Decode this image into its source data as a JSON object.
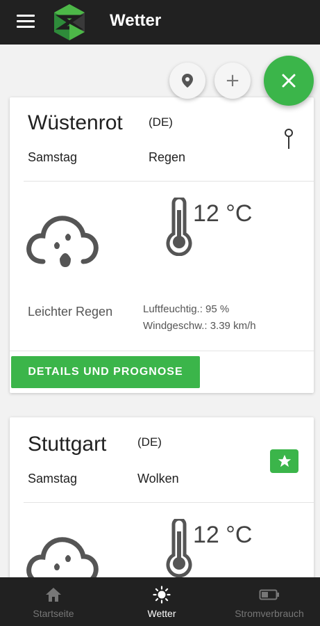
{
  "app": {
    "title": "Wetter"
  },
  "cards": [
    {
      "city": "Wüstenrot",
      "country": "(DE)",
      "day": "Samstag",
      "condition": "Regen",
      "temperature": "12 °C",
      "description": "Leichter Regen",
      "humidity": "Luftfeuchtig.: 95 %",
      "wind": "Windgeschw.: 3.39 km/h",
      "details_button": "DETAILS UND PROGNOSE"
    },
    {
      "city": "Stuttgart",
      "country": "(DE)",
      "day": "Samstag",
      "condition": "Wolken",
      "temperature": "12 °C"
    }
  ],
  "fab": {
    "add_symbol": "+"
  },
  "bottom_nav": [
    {
      "label": "Startseite",
      "icon": "home-icon"
    },
    {
      "label": "Wetter",
      "icon": "sun-icon"
    },
    {
      "label": "Stromverbrauch",
      "icon": "battery-icon"
    }
  ],
  "colors": {
    "accent": "#3bb54a",
    "bar": "#212121",
    "inactive": "#777777"
  }
}
